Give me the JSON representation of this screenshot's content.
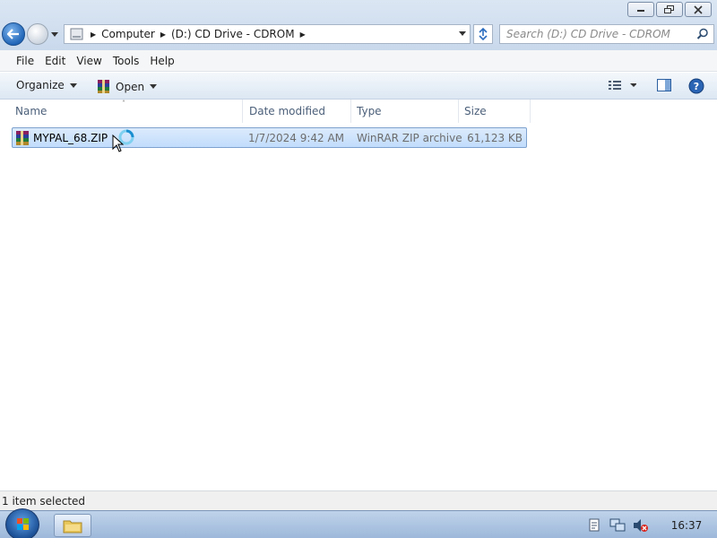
{
  "window": {
    "minimize_icon": "minimize-icon",
    "maximize_icon": "restore-icon",
    "close_icon": "close-icon"
  },
  "address_bar": {
    "breadcrumbs": [
      "Computer",
      "(D:) CD Drive - CDROM"
    ]
  },
  "search": {
    "placeholder": "Search (D:) CD Drive - CDROM"
  },
  "menu": {
    "items": [
      "File",
      "Edit",
      "View",
      "Tools",
      "Help"
    ]
  },
  "toolbar": {
    "organize_label": "Organize",
    "open_label": "Open"
  },
  "columns": {
    "name": "Name",
    "date_modified": "Date modified",
    "type": "Type",
    "size": "Size"
  },
  "files": [
    {
      "name": "MYPAL_68.ZIP",
      "date_modified": "1/7/2024 9:42 AM",
      "type": "WinRAR ZIP archive",
      "size": "61,123 KB",
      "selected": true
    }
  ],
  "status": {
    "text": "1 item selected"
  },
  "taskbar": {
    "clock": "16:37"
  },
  "colors": {
    "selection_bg": "#cce4fc",
    "selection_border": "#7da2ce",
    "header_text": "#4c607a"
  }
}
